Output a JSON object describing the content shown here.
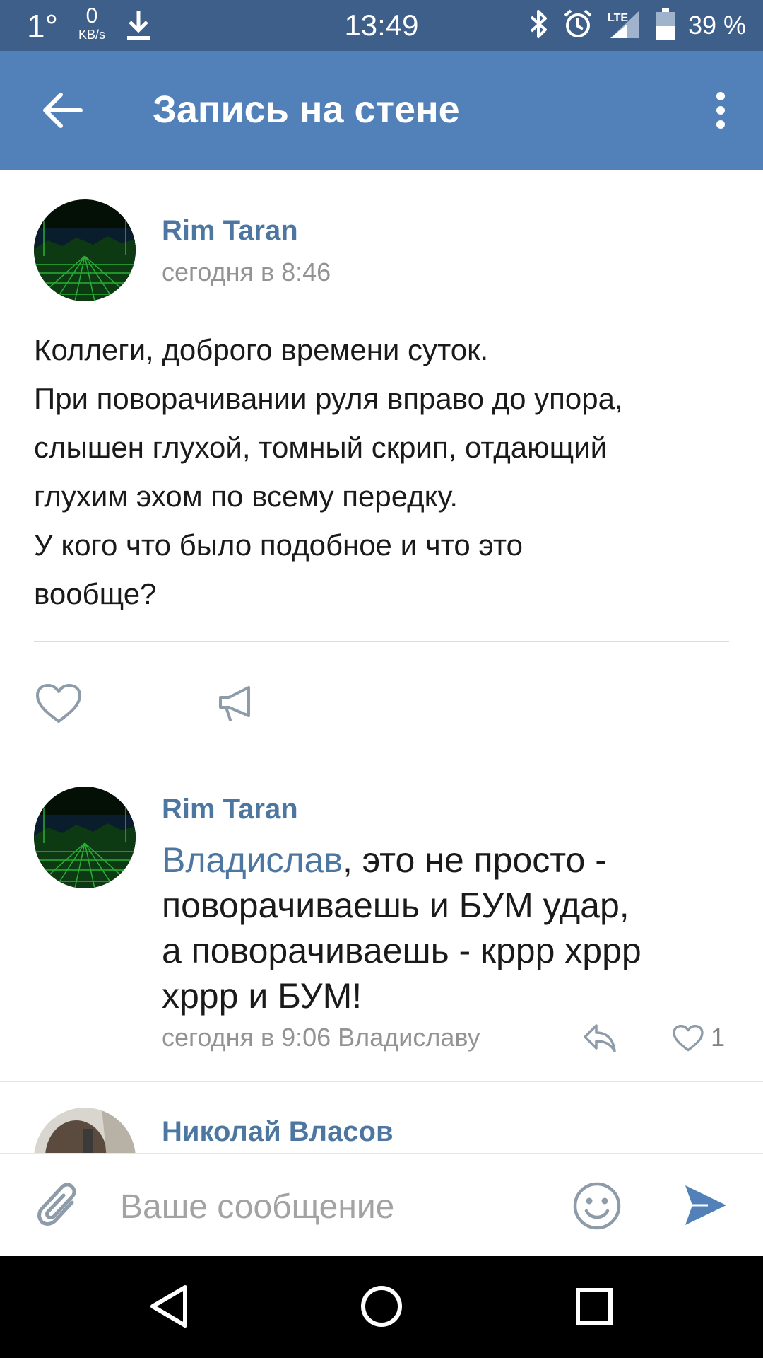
{
  "status_bar": {
    "temperature": "1°",
    "speed_value": "0",
    "speed_unit": "KB/s",
    "time": "13:49",
    "network": "LTE",
    "battery": "39 %"
  },
  "app_bar": {
    "title": "Запись на стене",
    "back_icon": "arrow-back-icon",
    "more_icon": "more-vert-icon"
  },
  "post": {
    "author": "Rim Taran",
    "time": "сегодня в 8:46",
    "text_lines": [
      "Коллеги, доброго времени суток.",
      "При поворачивании руля вправо до упора,",
      "слышен глухой, томный скрип, отдающий",
      "глухим эхом по всему передку.",
      "У кого что было подобное и что это",
      "вообще?"
    ]
  },
  "comments": [
    {
      "author": "Rim Taran",
      "mention": "Владислав",
      "first_line_rest": ", это не просто -",
      "text_lines": [
        "поворачиваешь и БУМ удар,",
        "а поворачиваешь - кррр хррр",
        "хррр и БУМ!"
      ],
      "meta": "сегодня в 9:06 Владиславу",
      "likes": "1"
    },
    {
      "author": "Николай Власов"
    }
  ],
  "composer": {
    "placeholder": "Ваше сообщение"
  },
  "colors": {
    "status_bar": "#3d5f8a",
    "app_bar": "#5181b8",
    "link": "#4d76a1",
    "send": "#5181b8",
    "secondary_text": "#939393"
  }
}
